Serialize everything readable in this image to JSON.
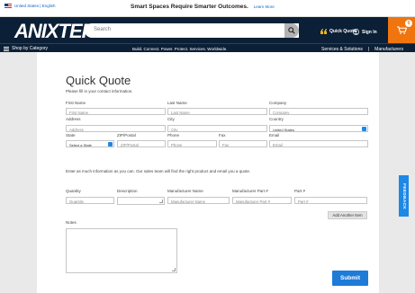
{
  "colors": {
    "brand_navy": "#0b1f36",
    "accent_orange": "#f0750f",
    "button_blue": "#1e7bd8",
    "link_blue": "#1565c0"
  },
  "promo": {
    "locale": "United States | English",
    "message": "Smart Spaces Require Smarter Outcomes.",
    "link": "Learn More"
  },
  "header": {
    "logo": "ANIXTER",
    "search_placeholder": "Search",
    "quick_quote": "Quick Quote",
    "sign_in": "Sign In",
    "cart_count": "0",
    "icons": [
      "us-flag-icon",
      "search-icon",
      "quick-quote-icon",
      "user-icon",
      "cart-icon",
      "menu-icon"
    ]
  },
  "nav": {
    "shop_by_category": "Shop by Category",
    "tagline": "Build. Connect. Power. Protect. Services. Worldwide.",
    "services": "Services & Solutions",
    "separator": "|",
    "manufacturers": "Manufacturers"
  },
  "form": {
    "title": "Quick Quote",
    "subtitle": "Please fill in your contact information.",
    "labels": {
      "first_name": "First Name",
      "last_name": "Last Name",
      "company": "Company",
      "address": "Address",
      "city": "City",
      "country": "Country",
      "state": "State",
      "zip": "ZIP/Postal",
      "phone": "Phone",
      "fax": "Fax",
      "email": "Email"
    },
    "placeholders": {
      "first_name": "First Name",
      "last_name": "Last Name",
      "company": "Company",
      "address": "Address",
      "city": "City",
      "zip": "ZIP/Postal",
      "phone": "Phone",
      "fax": "Fax",
      "email": "Email"
    },
    "country_value": "United States",
    "state_value": "Select a State",
    "items_note": "Enter as much information as you can. Our sales team will find the right product and email you a quote.",
    "item_labels": {
      "quantity": "Quantity",
      "description": "Description",
      "manufacturer_name": "Manufacturer Name",
      "manufacturer_part": "Manufacturer Part #",
      "part": "Part #"
    },
    "item_placeholders": {
      "quantity": "Quantity",
      "manufacturer_name": "Manufacturer Name",
      "manufacturer_part": "Manufacturer Part #",
      "part": "Part #"
    },
    "add_item": "Add Another Item",
    "notes_label": "Notes",
    "submit": "Submit"
  },
  "feedback": "FEEDBACK"
}
